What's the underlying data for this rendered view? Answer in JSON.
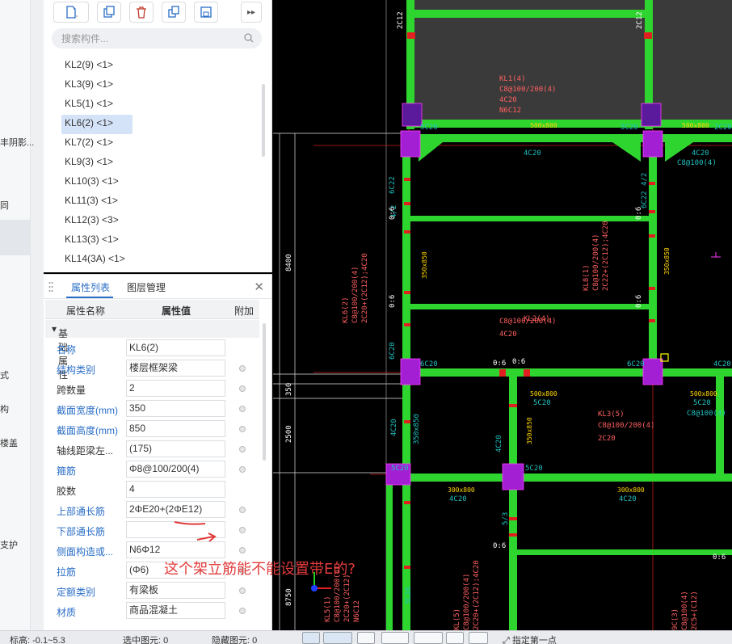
{
  "left_strip": {
    "labels": [
      "丰阴影...",
      "同",
      "式",
      "构",
      "楼盖",
      "支护"
    ]
  },
  "component_panel": {
    "search_placeholder": "搜索构件...",
    "items": [
      "KL2(9) <1>",
      "KL3(9) <1>",
      "KL5(1) <1>",
      "KL6(2) <1>",
      "KL7(2) <1>",
      "KL9(3) <1>",
      "KL10(3) <1>",
      "KL11(3) <1>",
      "KL12(3) <3>",
      "KL13(3) <1>",
      "KL14(3A) <1>"
    ],
    "selected_index": 3
  },
  "property_panel": {
    "tabs": [
      "属性列表",
      "图层管理"
    ],
    "headers": {
      "name": "属性名称",
      "value": "属性值",
      "extra": "附加"
    },
    "group": "基础属性",
    "rows": [
      {
        "name": "名称",
        "value": "KL6(2)",
        "color": "blue",
        "has_dot": false
      },
      {
        "name": "结构类别",
        "value": "楼层框架梁",
        "color": "blue",
        "has_dot": true
      },
      {
        "name": "跨数量",
        "value": "2",
        "color": "dark",
        "has_dot": true
      },
      {
        "name": "截面宽度(mm)",
        "value": "350",
        "color": "blue",
        "has_dot": true
      },
      {
        "name": "截面高度(mm)",
        "value": "850",
        "color": "blue",
        "has_dot": true
      },
      {
        "name": "轴线距梁左...",
        "value": "(175)",
        "color": "dark",
        "has_dot": true
      },
      {
        "name": "箍筋",
        "value": "Φ8@100/200(4)",
        "color": "blue",
        "has_dot": true
      },
      {
        "name": "胶数",
        "value": "4",
        "color": "dark",
        "has_dot": false
      },
      {
        "name": "上部通长筋",
        "value": "2ΦE20+(2ΦE12)",
        "color": "blue",
        "has_dot": true
      },
      {
        "name": "下部通长筋",
        "value": "",
        "color": "blue",
        "has_dot": true
      },
      {
        "name": "侧面构造或...",
        "value": "N6Φ12",
        "color": "blue",
        "has_dot": true
      },
      {
        "name": "拉筋",
        "value": "(Φ6)",
        "color": "blue",
        "has_dot": true
      },
      {
        "name": "定额类别",
        "value": "有梁板",
        "color": "blue",
        "has_dot": true
      },
      {
        "name": "材质",
        "value": "商品混凝土",
        "color": "blue",
        "has_dot": true
      }
    ]
  },
  "annotation": {
    "text": "这个架立筋能不能设置带E的?",
    "color": "#e23b3b"
  },
  "status_bar": {
    "elevation": "标高:   -0.1~5.3",
    "selected": "选中图元: 0",
    "hidden": "隐藏图元: 0",
    "hint": "指定第一点"
  },
  "cad": {
    "labels": {
      "kl1": "KL1(4)",
      "kl1_stirrup": "C8@100/200(4)",
      "kl1_top": "4C20",
      "kl1_side": "N6C12",
      "size1": "500x800",
      "size2": "500x800",
      "c5c20_a": "5C20",
      "c5c20_b": "5C20",
      "c2c20": "2C20",
      "c4c20": "4C20",
      "c4c20_r": "4C20",
      "c8_r": "C8@100(4)",
      "kl8": "KL8(1)",
      "kl8_stirrup": "C8@100/200(4)",
      "kl8_bars": "2C22+(2C12);4C20",
      "kl6": "KL6(2)",
      "kl6_stirrup": "C8@100/200(4)",
      "kl6_bars": "2C20+(2C12);4C20",
      "kl_mid": "KL2(4)",
      "kl_mid_stirrup": "C8@100/200(4)",
      "kl_mid_top": "4C20",
      "beam06_a": "0:6",
      "beam06_b": "0:6",
      "beam06_c": "0:6",
      "beam06_d": "0:6",
      "beam06_e": "0:6",
      "sec_350x850": "350x850",
      "sec_350x850_r": "350x850",
      "c6c20": "6C20",
      "c6c20_b": "6C20",
      "c4c20_b": "4C20",
      "size3": "500x800",
      "size4": "500x800",
      "kl3": "KL3(5)",
      "kl3_stirrup": "C8@100/200(4)",
      "kl3_top": "2C20",
      "c5c20_c": "5C20",
      "c5c20_d": "5C20",
      "c8_r2": "C8@100(4)",
      "sec_300x800": "300x800",
      "sec_300x800_b": "300x800",
      "c4c20_c": "4C20",
      "c4c20_d": "4C20",
      "c5c20_e": "5C20",
      "c4c20_e": "4C20",
      "dim8400": "8400",
      "dim350": "350",
      "dim2500": "2500",
      "dim8750": "8750",
      "kl5": "KL5(1)",
      "kl5_a": "C8@100/200(4)",
      "kl5_b": "2C20+(2C12)",
      "kl5_c": "N6C12",
      "kl_bl": "KL(5)",
      "kl_bl_b": "C8@100/200(4)",
      "kl_bl_c": "2C20+(2C12);4C20",
      "kl_bl2": "KL(5)",
      "kl_br": "9C(3)",
      "kl_br2": "C8@100(4)",
      "kl_br3": "2C5+(C12)",
      "c2c12_a": "2C12",
      "c2c12_b": "2C12",
      "side_42": "4/2",
      "side_42_b": "4/2",
      "side_53": "5/3",
      "c6c22": "6C22",
      "c6c22_b": "6C22",
      "c6c22_c": "6C20",
      "cols_350x850": "350x850",
      "cols_3c20": "3C20"
    }
  }
}
